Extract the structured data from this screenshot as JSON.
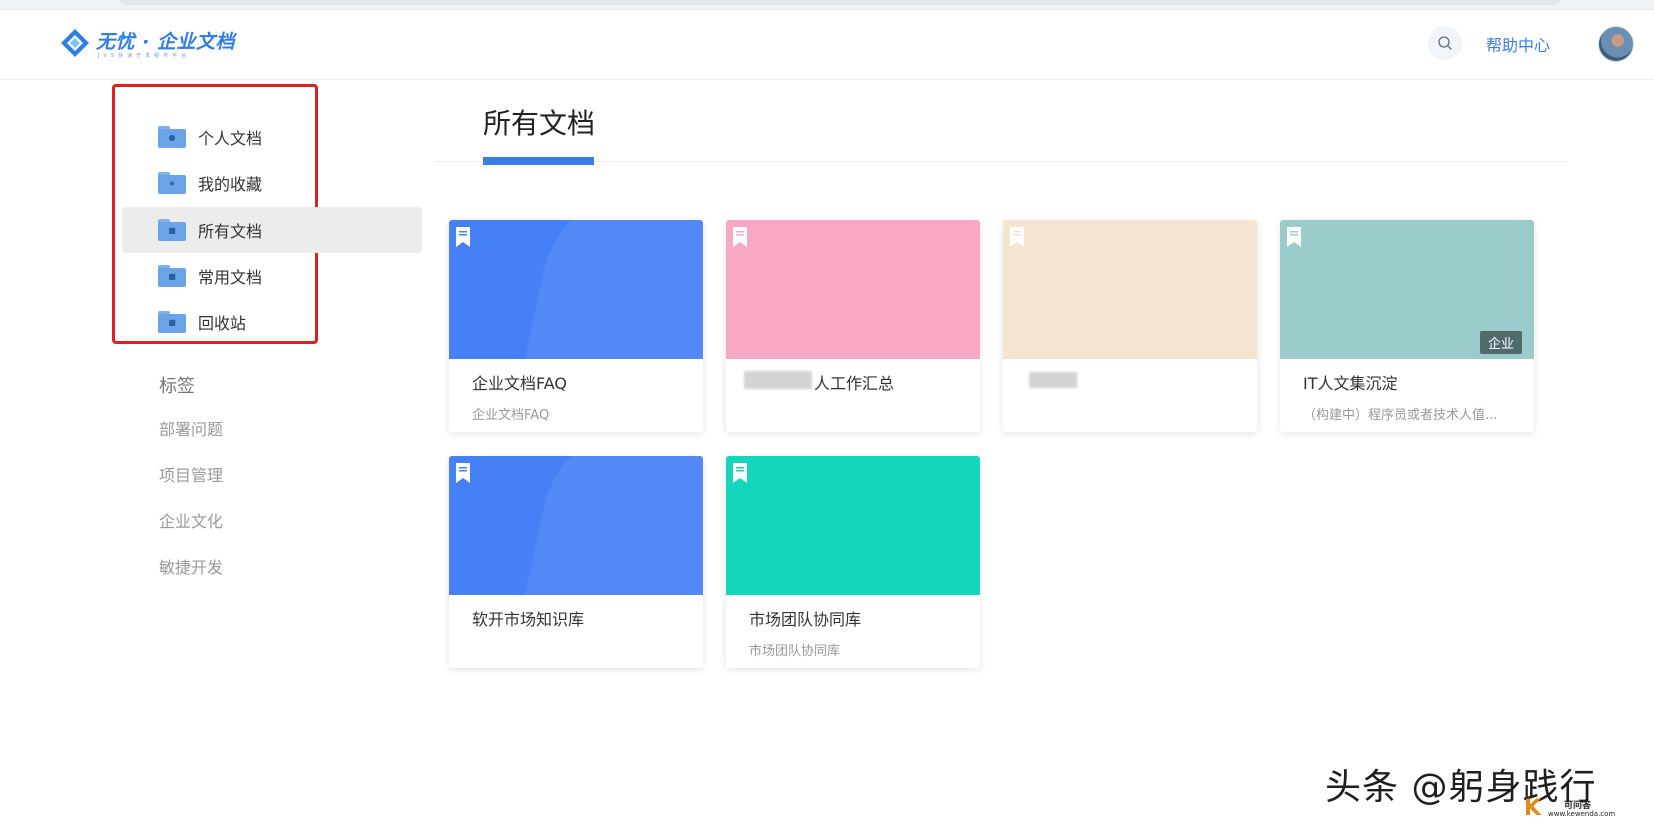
{
  "header": {
    "logo_text": "无忧 · 企业文档",
    "logo_subtext": "JVS快速开发服务平台",
    "help_label": "帮助中心",
    "brand_color": "#3b7de8"
  },
  "sidebar": {
    "items": [
      {
        "label": "个人文档",
        "icon": "person-folder-icon",
        "active": false
      },
      {
        "label": "我的收藏",
        "icon": "star-folder-icon",
        "active": false
      },
      {
        "label": "所有文档",
        "icon": "doc-folder-icon",
        "active": true
      },
      {
        "label": "常用文档",
        "icon": "doc-folder-icon",
        "active": false
      },
      {
        "label": "回收站",
        "icon": "trash-folder-icon",
        "active": false
      }
    ],
    "tags_title": "标签",
    "tags": [
      "部署问题",
      "项目管理",
      "企业文化",
      "敏捷开发"
    ]
  },
  "main": {
    "title": "所有文档",
    "cards": [
      {
        "name": "企业文档FAQ",
        "desc": "企业文档FAQ",
        "color": "#4580f7",
        "badge": ""
      },
      {
        "name": "人工作汇总",
        "desc": "",
        "color": "#f7a8c4",
        "badge": "",
        "name_partially_redacted": true
      },
      {
        "name": "",
        "desc": "",
        "color": "#f4e5d1",
        "badge": "",
        "name_redacted": true
      },
      {
        "name": "IT人文集沉淀",
        "desc": "（构建中）程序员或者技术人值...",
        "color": "#99cccb",
        "badge": "企业"
      },
      {
        "name": "软开市场知识库",
        "desc": "",
        "color": "#4580f7",
        "badge": ""
      },
      {
        "name": "市场团队协同库",
        "desc": "市场团队协同库",
        "color": "#14d6bd",
        "badge": ""
      }
    ]
  },
  "watermark": {
    "text": "头条 @躬身践行",
    "logo_k": "K",
    "logo_cn": "可问答",
    "logo_url": "www.kewenda.com"
  }
}
